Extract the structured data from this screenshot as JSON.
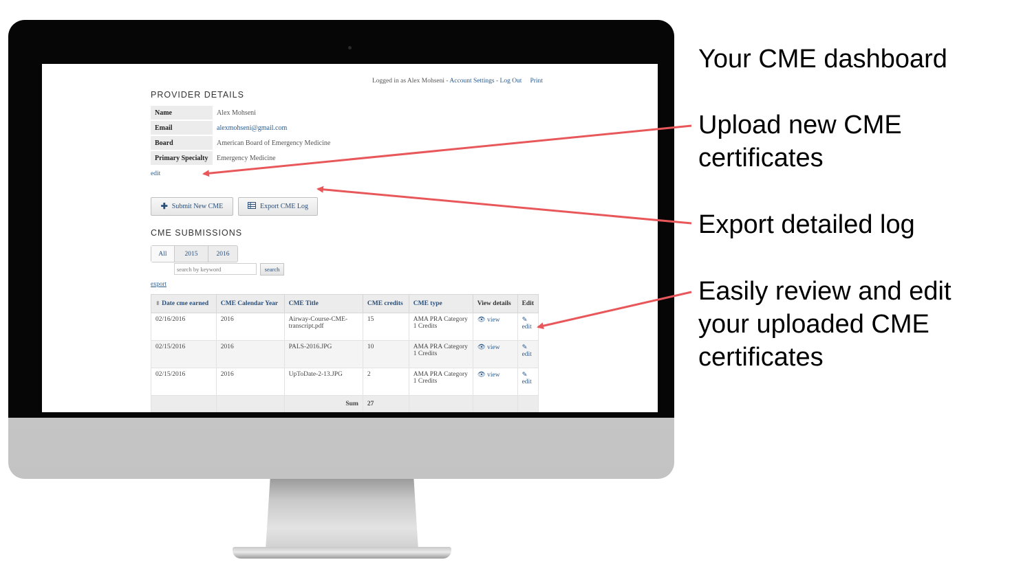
{
  "header": {
    "logged_in_prefix": "Logged in as Alex Mohseni - ",
    "account_settings": "Account Settings",
    "sep": " - ",
    "logout": "Log Out",
    "print": "Print"
  },
  "provider": {
    "title": "PROVIDER DETAILS",
    "rows": [
      {
        "label": "Name",
        "value": "Alex Mohseni"
      },
      {
        "label": "Email",
        "value": "alexmohseni@gmail.com"
      },
      {
        "label": "Board",
        "value": "American Board of Emergency Medicine"
      },
      {
        "label": "Primary Specialty",
        "value": "Emergency Medicine"
      }
    ],
    "edit": "edit"
  },
  "actions": {
    "submit": "Submit New CME",
    "export_log": "Export CME Log"
  },
  "submissions": {
    "title": "CME SUBMISSIONS",
    "tabs": [
      "All",
      "2015",
      "2016"
    ],
    "search_placeholder": "search by keyword",
    "search_button": "search",
    "export": "export",
    "sort_icon": "⬍",
    "columns": [
      "Date cme earned",
      "CME Calendar Year",
      "CME Title",
      "CME credits",
      "CME type",
      "View details",
      "Edit"
    ],
    "rows": [
      {
        "date": "02/16/2016",
        "year": "2016",
        "title": "Airway-Course-CME-transcript.pdf",
        "credits": "15",
        "type": "AMA PRA Category 1 Credits",
        "view": "view",
        "edit": "edit"
      },
      {
        "date": "02/15/2016",
        "year": "2016",
        "title": "PALS-2016.JPG",
        "credits": "10",
        "type": "AMA PRA Category 1 Credits",
        "view": "view",
        "edit": "edit"
      },
      {
        "date": "02/15/2016",
        "year": "2016",
        "title": "UpToDate-2-13.JPG",
        "credits": "2",
        "type": "AMA PRA Category 1 Credits",
        "view": "view",
        "edit": "edit"
      }
    ],
    "sum_label": "Sum",
    "sum_value": "27"
  },
  "callouts": {
    "dashboard": "Your CME dashboard",
    "upload": [
      "Upload new CME",
      "certificates"
    ],
    "export": "Export detailed log",
    "review": [
      "Easily review and edit",
      "your uploaded CME",
      "certificates"
    ]
  },
  "colors": {
    "arrow": "#e8575a",
    "link": "#2a5a8c",
    "bezel": "#060606",
    "chassis": "#c8c8c8"
  },
  "icons": {
    "plus": "plus-icon",
    "table": "table-icon",
    "eye": "eye-icon",
    "pencil": "pencil-icon",
    "sort": "sort-icon"
  }
}
